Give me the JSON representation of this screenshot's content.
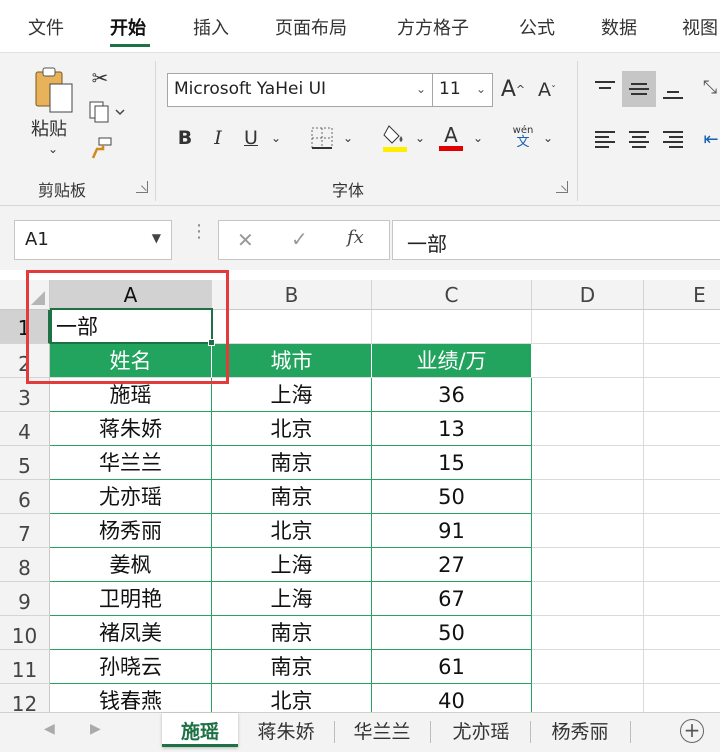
{
  "ribbon_tabs": [
    "文件",
    "开始",
    "插入",
    "页面布局",
    "方方格子",
    "公式",
    "数据",
    "视图"
  ],
  "active_tab": "开始",
  "clipboard": {
    "paste_label": "粘贴",
    "group_label": "剪贴板"
  },
  "font_group": {
    "font_name": "Microsoft YaHei UI",
    "font_size": "11",
    "group_label": "字体",
    "bold": "B",
    "italic": "I",
    "underline": "U",
    "grow": "A",
    "shrink": "A",
    "font_color": "A",
    "phonetic_top": "wén",
    "phonetic_bottom": "文"
  },
  "colors": {
    "accent": "#1e7145",
    "table_header": "#22a35e",
    "highlight": "#e23b3b",
    "fill_yellow": "#ffee00",
    "font_red": "#e00000"
  },
  "formula_bar": {
    "name_box": "A1",
    "fx": "fx",
    "content": "一部"
  },
  "grid": {
    "columns": [
      "A",
      "B",
      "C",
      "D",
      "E"
    ],
    "rows": [
      "1",
      "2",
      "3",
      "4",
      "5",
      "6",
      "7",
      "8",
      "9",
      "10",
      "11",
      "12"
    ],
    "a1_value": "一部",
    "header": [
      "姓名",
      "城市",
      "业绩/万"
    ],
    "records": [
      [
        "施瑶",
        "上海",
        "36"
      ],
      [
        "蒋朱娇",
        "北京",
        "13"
      ],
      [
        "华兰兰",
        "南京",
        "15"
      ],
      [
        "尤亦瑶",
        "南京",
        "50"
      ],
      [
        "杨秀丽",
        "北京",
        "91"
      ],
      [
        "姜枫",
        "上海",
        "27"
      ],
      [
        "卫明艳",
        "上海",
        "67"
      ],
      [
        "褚凤美",
        "南京",
        "50"
      ],
      [
        "孙晓云",
        "南京",
        "61"
      ],
      [
        "钱春燕",
        "北京",
        "40"
      ]
    ]
  },
  "sheet_tabs": [
    "施瑶",
    "蒋朱娇",
    "华兰兰",
    "尤亦瑶",
    "杨秀丽"
  ],
  "active_sheet": "施瑶"
}
